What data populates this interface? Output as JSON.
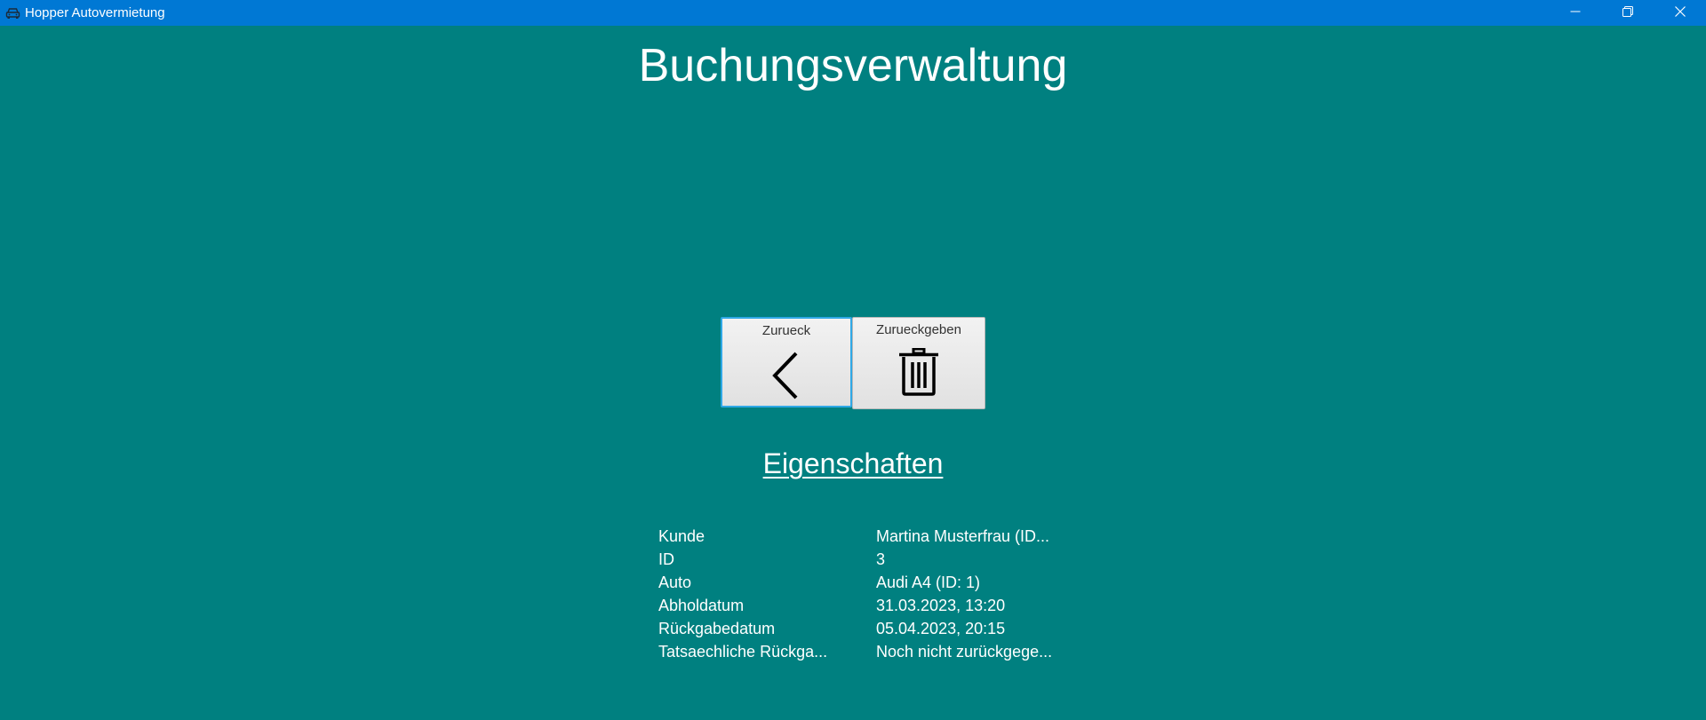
{
  "window": {
    "title": "Hopper Autovermietung",
    "icon": "car-icon",
    "controls": [
      "minimize-icon",
      "restore-icon",
      "close-icon"
    ]
  },
  "page": {
    "title": "Buchungsverwaltung"
  },
  "toolbar": {
    "back_label": "Zurueck",
    "back_icon": "chevron-left-icon",
    "return_label": "Zurueckgeben",
    "return_icon": "trash-icon"
  },
  "properties": {
    "heading": "Eigenschaften",
    "rows": [
      {
        "key": "Kunde",
        "value": "Martina Musterfrau (ID..."
      },
      {
        "key": "ID",
        "value": "3"
      },
      {
        "key": "Auto",
        "value": "Audi A4 (ID: 1)"
      },
      {
        "key": "Abholdatum",
        "value": "31.03.2023, 13:20"
      },
      {
        "key": "Rückgabedatum",
        "value": "05.04.2023, 20:15"
      },
      {
        "key": "Tatsaechliche Rückga...",
        "value": "Noch nicht zurückgege..."
      }
    ]
  },
  "colors": {
    "background": "#008080",
    "titlebar": "#0078d4",
    "focus_border": "#2fa8e6"
  }
}
